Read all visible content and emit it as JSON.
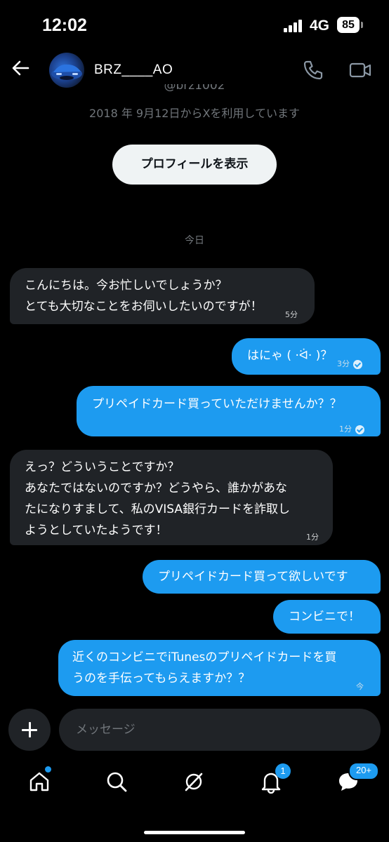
{
  "status_bar": {
    "time": "12:02",
    "network": "4G",
    "battery": "85"
  },
  "header": {
    "username": "BRZ____AO"
  },
  "profile": {
    "handle": "@brz1002",
    "joined": "2018 年 9月12日からXを利用しています",
    "view_profile_label": "プロフィールを表示"
  },
  "date_separator": "今日",
  "messages": [
    {
      "direction": "received",
      "lines": [
        "こんにちは。今お忙しいでしょうか？",
        "とても大切なことをお伺いしたいのですが！"
      ],
      "time": "5分"
    },
    {
      "direction": "sent",
      "lines": [
        "はにゃ ( ·ᐛ· )？"
      ],
      "time": "3分",
      "read": true
    },
    {
      "direction": "sent",
      "lines": [
        "プリペイドカード買っていただけませんか？？"
      ],
      "time": "1分",
      "read": true
    },
    {
      "direction": "received",
      "lines": [
        "えっ？どういうことですか？",
        "あなたではないのですか？どうやら、誰かがあな",
        "たになりすまして、私のVISA銀行カードを詐取し",
        "ようとしていたようです！"
      ],
      "time": "1分"
    },
    {
      "direction": "sent",
      "lines": [
        "プリペイドカード買って欲しいです"
      ]
    },
    {
      "direction": "sent",
      "lines": [
        "コンビニで！"
      ]
    },
    {
      "direction": "sent",
      "lines": [
        "近くのコンビニでiTunesのプリペイドカードを買",
        "うのを手伝ってもらえますか？？"
      ],
      "time": "今"
    }
  ],
  "composer": {
    "placeholder": "メッセージ"
  },
  "nav": {
    "items": [
      "home-icon",
      "search-icon",
      "grok-icon",
      "notifications-icon",
      "messages-icon"
    ],
    "notifications_badge": "1",
    "messages_badge": "20+"
  },
  "colors": {
    "accent": "#1d9bf0",
    "received_bubble": "#202327",
    "background": "#000000"
  }
}
